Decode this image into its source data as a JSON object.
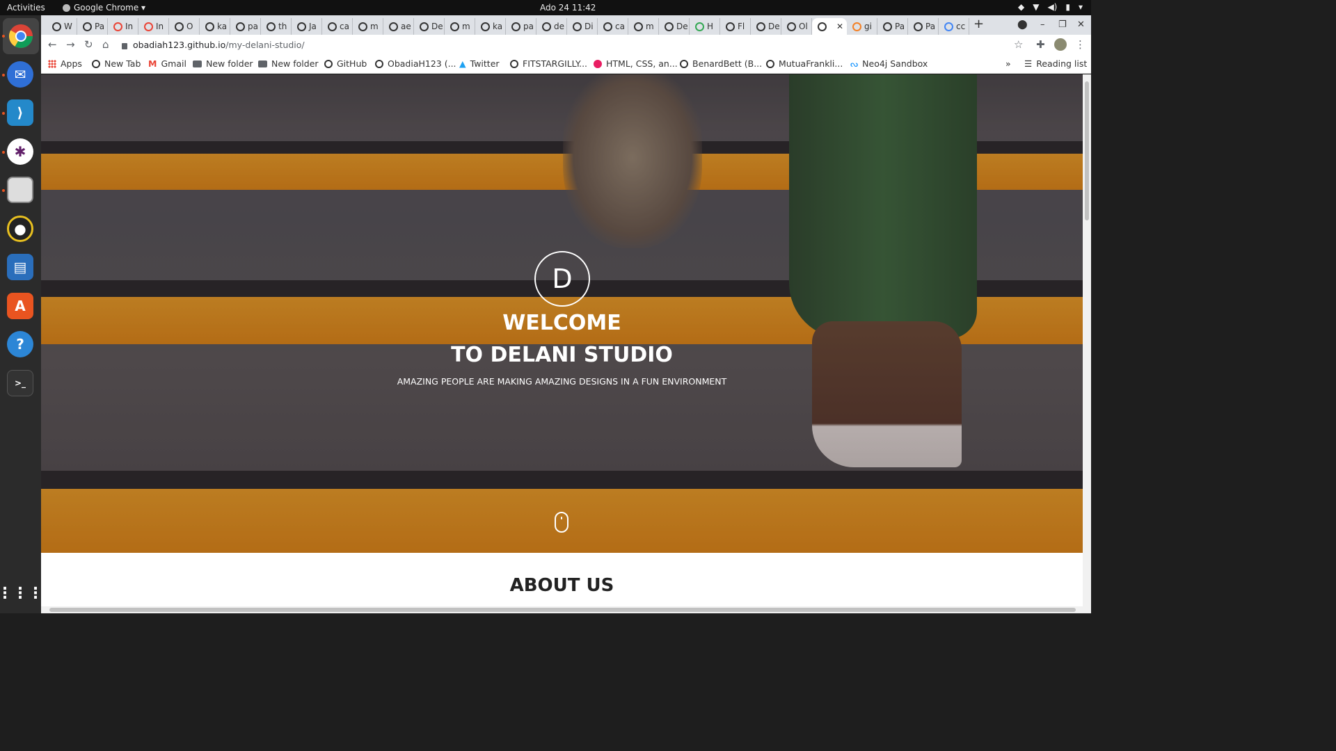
{
  "topbar": {
    "activities": "Activities",
    "app_name": "Google Chrome ▾",
    "clock": "Ado 24  11:42"
  },
  "dock": {
    "icons": [
      "chrome-icon",
      "thunderbird-icon",
      "vscode-icon",
      "slack-icon",
      "files-icon",
      "rhythmbox-icon",
      "writer-icon",
      "software-icon",
      "help-icon",
      "terminal-icon",
      "show-apps-icon"
    ]
  },
  "tabs": [
    {
      "label": "W"
    },
    {
      "label": "Pa"
    },
    {
      "label": "In"
    },
    {
      "label": "In"
    },
    {
      "label": "O"
    },
    {
      "label": "ka"
    },
    {
      "label": "pa"
    },
    {
      "label": "th"
    },
    {
      "label": "Ja"
    },
    {
      "label": "ca"
    },
    {
      "label": "m"
    },
    {
      "label": "ae"
    },
    {
      "label": "De"
    },
    {
      "label": "m"
    },
    {
      "label": "ka"
    },
    {
      "label": "pa"
    },
    {
      "label": "de"
    },
    {
      "label": "Di"
    },
    {
      "label": "ca"
    },
    {
      "label": "m"
    },
    {
      "label": "De"
    },
    {
      "label": "H"
    },
    {
      "label": "Fl"
    },
    {
      "label": "De"
    },
    {
      "label": "Ol"
    },
    {
      "label": ""
    },
    {
      "label": "gi"
    },
    {
      "label": "Pa"
    },
    {
      "label": "Pa"
    },
    {
      "label": "cc"
    }
  ],
  "address_bar": {
    "host": "obadiah123.github.io",
    "path": "/my-delani-studio/"
  },
  "bookmarks": {
    "items": [
      "Apps",
      "New Tab",
      "Gmail",
      "New folder",
      "New folder",
      "GitHub",
      "ObadiaH123 (...",
      "Twitter",
      "FITSTARGILLY...",
      "HTML, CSS, an...",
      "BenardBett (B...",
      "MutuaFrankli...",
      "Neo4j Sandbox"
    ],
    "overflow": "»",
    "reading_list": "Reading list"
  },
  "hero": {
    "logo_letter": "D",
    "title_line1": "WELCOME",
    "title_line2": "TO DELANI STUDIO",
    "subtitle": "AMAZING PEOPLE ARE MAKING AMAZING DESIGNS IN A FUN ENVIRONMENT"
  },
  "about": {
    "title": "ABOUT US"
  }
}
